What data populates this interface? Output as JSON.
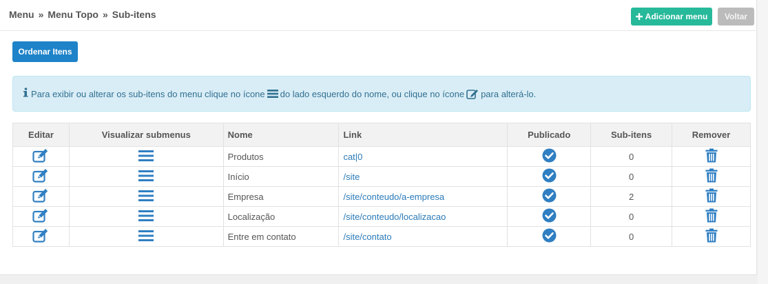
{
  "breadcrumb": {
    "items": [
      "Menu",
      "Menu Topo",
      "Sub-itens"
    ],
    "separator": "»"
  },
  "toolbar": {
    "add_label": "Adicionar menu",
    "back_label": "Voltar",
    "order_label": "Ordenar Itens"
  },
  "alert": {
    "part1": "Para exibir ou alterar os sub-itens do menu clique no ícone",
    "part2": "do lado esquerdo do nome, ou clique no ícone",
    "part3": "para alterá-lo."
  },
  "table": {
    "headers": [
      "Editar",
      "Visualizar submenus",
      "Nome",
      "Link",
      "Publicado",
      "Sub-itens",
      "Remover"
    ],
    "rows": [
      {
        "name": "Produtos",
        "link": "cat|0",
        "published": true,
        "subitems": "0"
      },
      {
        "name": "Início",
        "link": "/site",
        "published": true,
        "subitems": "0"
      },
      {
        "name": "Empresa",
        "link": "/site/conteudo/a-empresa",
        "published": true,
        "subitems": "2"
      },
      {
        "name": "Localização",
        "link": "/site/conteudo/localizacao",
        "published": true,
        "subitems": "0"
      },
      {
        "name": "Entre em contato",
        "link": "/site/contato",
        "published": true,
        "subitems": "0"
      }
    ]
  },
  "icons": {
    "edit": "edit-icon",
    "submenu": "bars-icon",
    "published": "check-circle-icon",
    "remove": "trash-icon",
    "info": "info-icon",
    "add": "plus-icon"
  },
  "colors": {
    "primary": "#1e83c9",
    "success": "#26b99a",
    "muted": "#bbbbbb",
    "icon_blue": "#2f7fc2",
    "alert_bg": "#d9edf7",
    "alert_text": "#31708f",
    "link": "#2a7ab8"
  }
}
